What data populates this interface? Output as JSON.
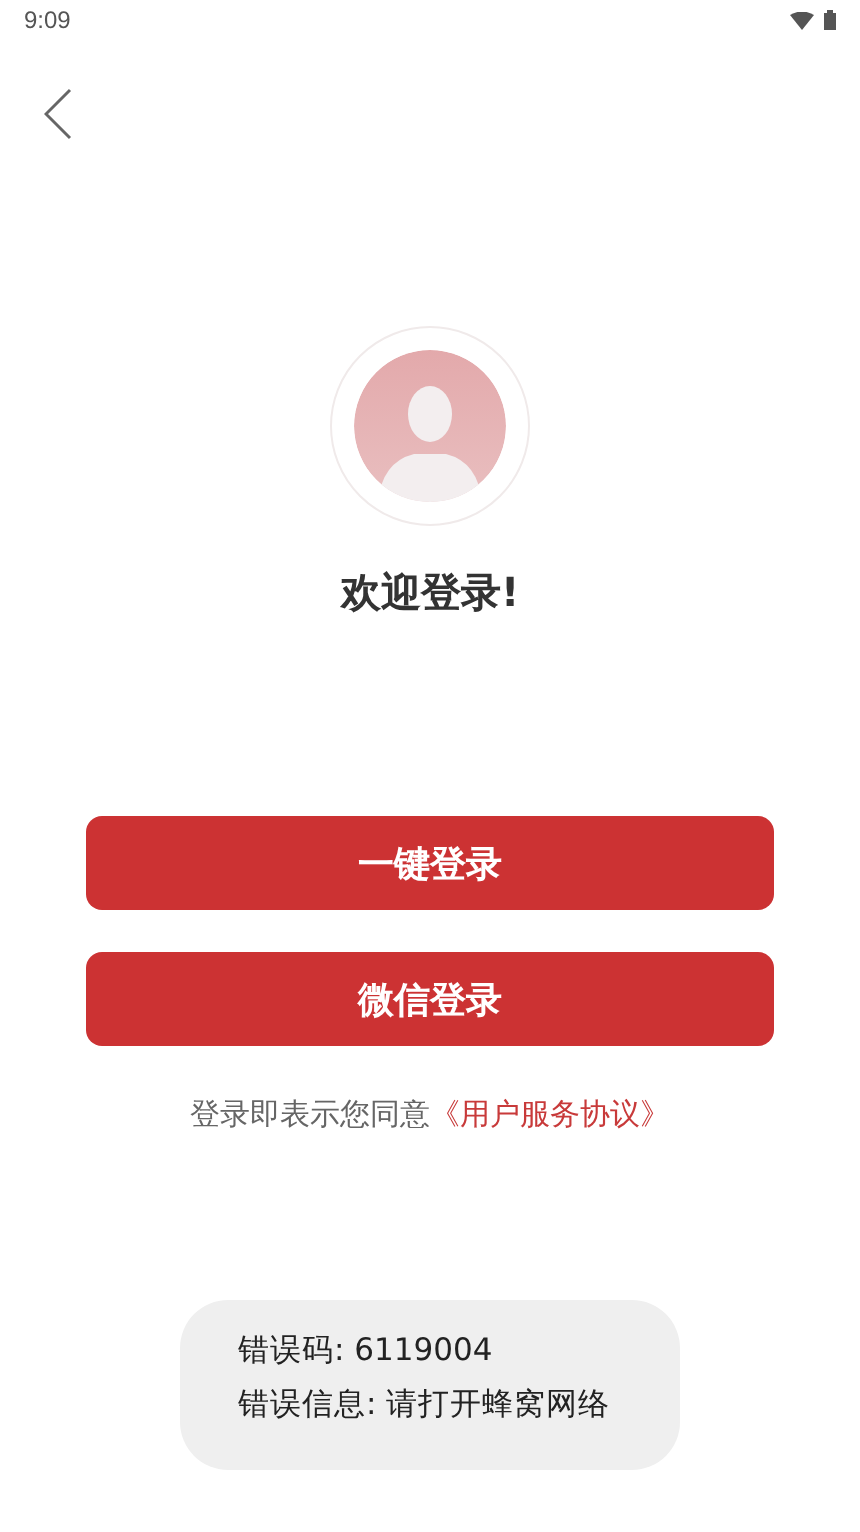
{
  "status_bar": {
    "time": "9:09"
  },
  "title": "欢迎登录!",
  "buttons": [
    {
      "label": "一键登录"
    },
    {
      "label": "微信登录"
    }
  ],
  "agreement": {
    "text": "登录即表示您同意",
    "link": "《用户服务协议》"
  },
  "toast": {
    "lines": [
      "错误码: 6119004",
      "错误信息: 请打开蜂窝网络"
    ]
  }
}
